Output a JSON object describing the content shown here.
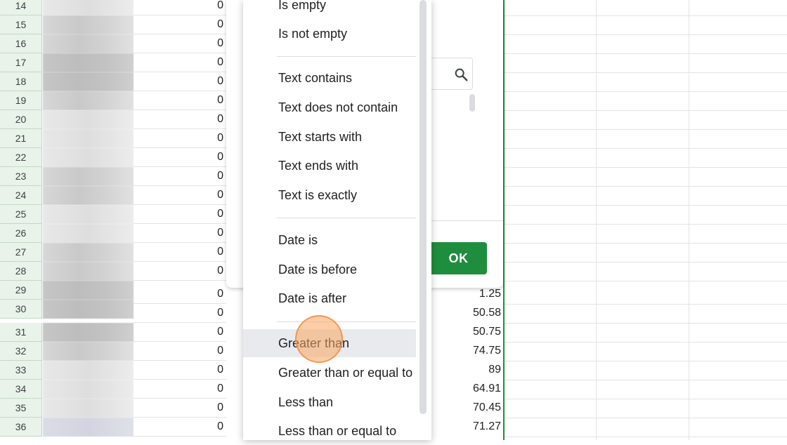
{
  "sheet": {
    "row_numbers": [
      "14",
      "15",
      "16",
      "17",
      "18",
      "19",
      "20",
      "21",
      "22",
      "23",
      "24",
      "25",
      "26",
      "27",
      "28",
      "29",
      "30",
      "31",
      "32",
      "33",
      "34",
      "35",
      "36"
    ],
    "col_c_values": [
      "0",
      "0",
      "0",
      "0",
      "0",
      "0",
      "0",
      "0",
      "0",
      "0",
      "0",
      "0",
      "0",
      "0",
      "0",
      "0",
      "0",
      "0",
      "0",
      "0",
      "0",
      "0",
      "0"
    ],
    "col_partial_values": [
      "1.25",
      "50.58",
      "50.75",
      "74.75",
      "89",
      "64.91",
      "70.45",
      "71.27"
    ]
  },
  "filter_panel": {
    "ok_label": "OK",
    "search_icon": "search-icon"
  },
  "condition_menu": {
    "items": [
      "Is empty",
      "Is not empty",
      "Text contains",
      "Text does not contain",
      "Text starts with",
      "Text ends with",
      "Text is exactly",
      "Date is",
      "Date is before",
      "Date is after",
      "Greater than",
      "Greater than or equal to",
      "Less than",
      "Less than or equal to"
    ],
    "hovered_item": "Greater than"
  },
  "colors": {
    "accent_green": "#1e8e3e",
    "row_header_bg": "#e9f3ea",
    "hover_bg": "#e8eaed",
    "click_indicator": "#f7a661"
  }
}
